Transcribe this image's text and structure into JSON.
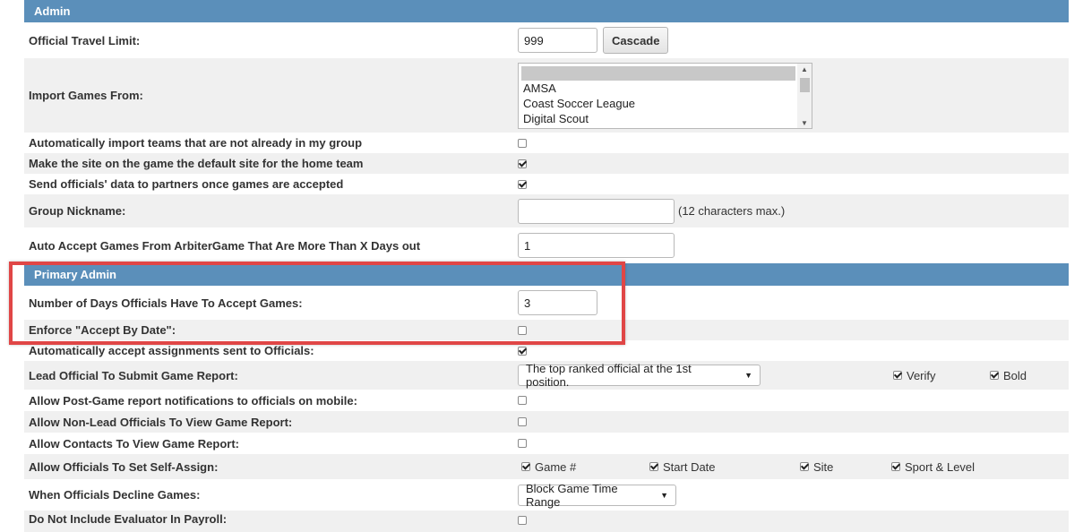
{
  "admin": {
    "header": "Admin",
    "travel_limit": {
      "label": "Official Travel Limit:",
      "value": "999",
      "button": "Cascade"
    },
    "import_games": {
      "label": "Import Games From:",
      "options": [
        "",
        "AMSA",
        "Coast Soccer League",
        "Digital Scout"
      ]
    },
    "auto_import_teams": {
      "label": "Automatically import teams that are not already in my group",
      "checked": false
    },
    "default_site": {
      "label": "Make the site on the game the default site for the home team",
      "checked": true
    },
    "send_officials_data": {
      "label": "Send officials' data to partners once games are accepted",
      "checked": true
    },
    "group_nickname": {
      "label": "Group Nickname:",
      "value": "",
      "note": "(12 characters max.)"
    },
    "auto_accept_days": {
      "label": "Auto Accept Games From ArbiterGame That Are More Than X Days out",
      "value": "1"
    }
  },
  "primary_admin": {
    "header": "Primary Admin",
    "days_to_accept": {
      "label": "Number of Days Officials Have To Accept Games:",
      "value": "3"
    },
    "enforce_accept_by": {
      "label": "Enforce \"Accept By Date\":",
      "checked": false
    },
    "auto_accept_assignments": {
      "label": "Automatically accept assignments sent to Officials:",
      "checked": true
    },
    "lead_official": {
      "label": "Lead Official To Submit Game Report:",
      "selected": "The top ranked official at the 1st position.",
      "verify_label": "Verify",
      "verify_checked": true,
      "bold_label": "Bold",
      "bold_checked": true
    },
    "post_game_notifications": {
      "label": "Allow Post-Game report notifications to officials on mobile:",
      "checked": false
    },
    "non_lead_view": {
      "label": "Allow Non-Lead Officials To View Game Report:",
      "checked": false
    },
    "contacts_view": {
      "label": "Allow Contacts To View Game Report:",
      "checked": false
    },
    "self_assign": {
      "label": "Allow Officials To Set Self-Assign:",
      "options": [
        {
          "label": "Game #",
          "checked": true
        },
        {
          "label": "Start Date",
          "checked": true
        },
        {
          "label": "Site",
          "checked": true
        },
        {
          "label": "Sport & Level",
          "checked": true
        }
      ]
    },
    "decline_games": {
      "label": "When Officials Decline Games:",
      "selected": "Block Game Time Range"
    },
    "exclude_evaluator": {
      "label": "Do Not Include Evaluator In Payroll:",
      "checked": false
    }
  },
  "colors": {
    "header_bg": "#5b8fba",
    "highlight": "#e04646"
  }
}
